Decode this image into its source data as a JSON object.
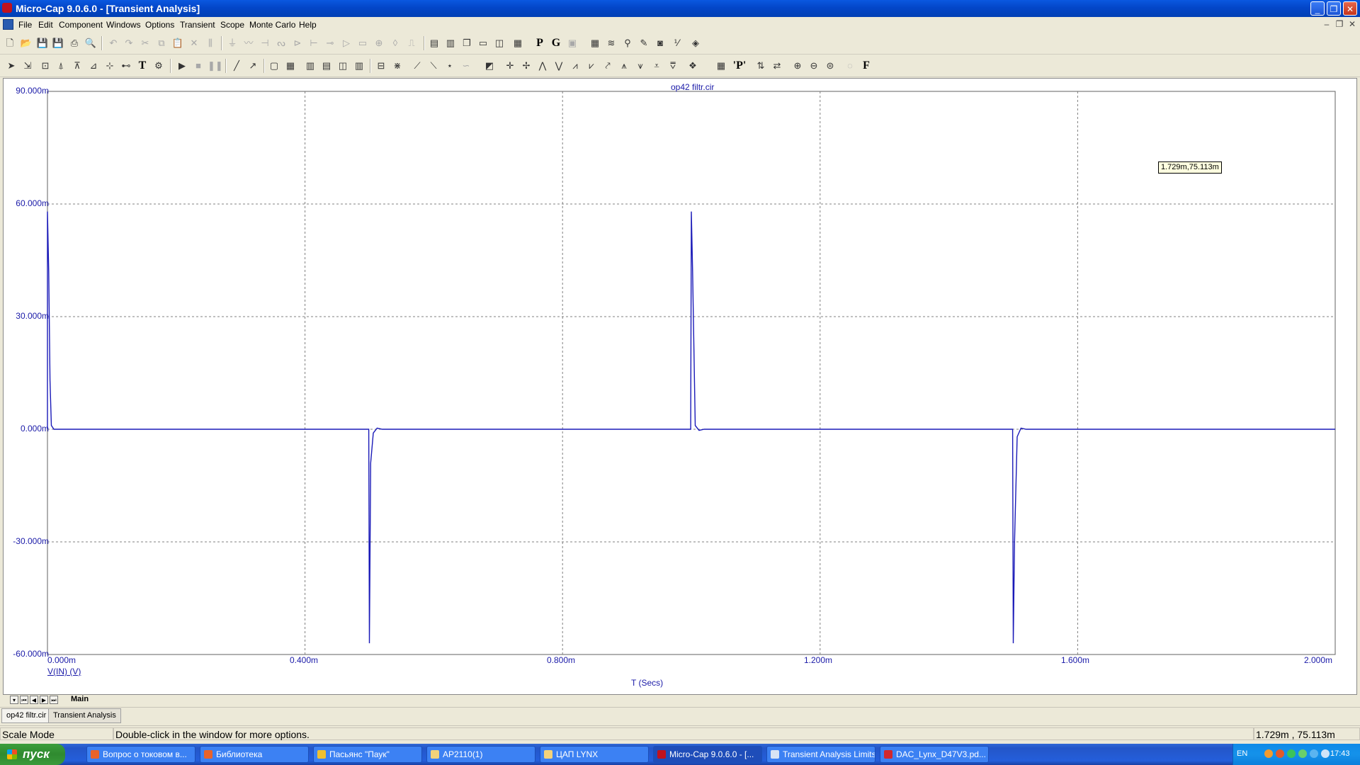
{
  "window": {
    "title": "Micro-Cap 9.0.6.0 - [Transient Analysis]",
    "controls": {
      "minimize": "_",
      "restore": "❐",
      "close": "✕"
    }
  },
  "menu": [
    "File",
    "Edit",
    "Component",
    "Windows",
    "Options",
    "Transient",
    "Scope",
    "Monte Carlo",
    "Help"
  ],
  "mdi_controls": [
    "–",
    "❐",
    "✕"
  ],
  "toolbar_text": {
    "p_btn": "P",
    "g_btn": "G",
    "p_btn2": "'P'",
    "f_btn": "F"
  },
  "plot": {
    "circuit_name": "op42 filtr.cir",
    "y_axis_label": "V(IN) (V)",
    "x_axis_label": "T (Secs)",
    "cursor_readout": "1.729m,75.113m",
    "y_ticks": [
      "90.000m",
      "60.000m",
      "30.000m",
      "0.000m",
      "-30.000m",
      "-60.000m"
    ],
    "x_ticks": [
      "0.000m",
      "0.400m",
      "0.800m",
      "1.200m",
      "1.600m",
      "2.000m"
    ],
    "trace_color": "#1a1ab8",
    "grid_color": "#808080"
  },
  "chart_data": {
    "type": "line",
    "title": "op42 filtr.cir",
    "xlabel": "T (Secs)",
    "ylabel": "V(IN) (V)",
    "xlim": [
      0,
      0.002
    ],
    "ylim": [
      -0.06,
      0.09
    ],
    "grid": true,
    "series": [
      {
        "name": "V(IN)",
        "x": [
          0.0,
          0.0,
          2e-06,
          4e-06,
          6e-06,
          1e-05,
          0.000499,
          0.0005,
          0.000502,
          0.000506,
          0.000512,
          0.00052,
          0.000999,
          0.001,
          0.001002,
          0.001006,
          0.001012,
          0.00102,
          0.001499,
          0.0015,
          0.001502,
          0.001506,
          0.001512,
          0.00152,
          0.002
        ],
        "y": [
          0.0,
          0.058,
          0.042,
          0.013,
          0.001,
          0.0,
          0.0,
          -0.057,
          -0.009,
          -0.001,
          0.0003,
          0.0,
          0.0,
          0.058,
          0.042,
          0.001,
          -0.0003,
          0.0,
          0.0,
          -0.057,
          -0.03,
          -0.002,
          0.0003,
          0.0,
          0.0
        ]
      }
    ]
  },
  "nav": {
    "page_tab": "Main"
  },
  "doc_tabs": [
    "op42 filtr.cir",
    "Transient Analysis"
  ],
  "status": {
    "mode": "Scale Mode",
    "hint": "Double-click in the window for more options.",
    "coords": "1.729m , 75.113m"
  },
  "taskbar": {
    "start": "пуск",
    "tasks": [
      {
        "label": "Вопрос о токовом в...",
        "icon_color": "#e8632b",
        "icon": "browser-icon"
      },
      {
        "label": "Библиотека",
        "icon_color": "#e8632b",
        "icon": "browser-icon"
      },
      {
        "label": "Пасьянс \"Паук\"",
        "icon_color": "#f0c030",
        "icon": "cards-icon"
      },
      {
        "label": "AP2110(1)",
        "icon_color": "#f3d27a",
        "icon": "folder-icon"
      },
      {
        "label": "ЦАП LYNX",
        "icon_color": "#f3d27a",
        "icon": "folder-icon"
      },
      {
        "label": "Micro-Cap 9.0.6.0 - [...",
        "icon_color": "#c0121e",
        "icon": "microcap-icon"
      },
      {
        "label": "Transient Analysis Limits",
        "icon_color": "#d8e4f4",
        "icon": "dialog-icon"
      },
      {
        "label": "DAC_Lynx_D47V3.pd...",
        "icon_color": "#d0282e",
        "icon": "pdf-icon"
      }
    ],
    "lang": "EN",
    "clock": "17:43"
  }
}
